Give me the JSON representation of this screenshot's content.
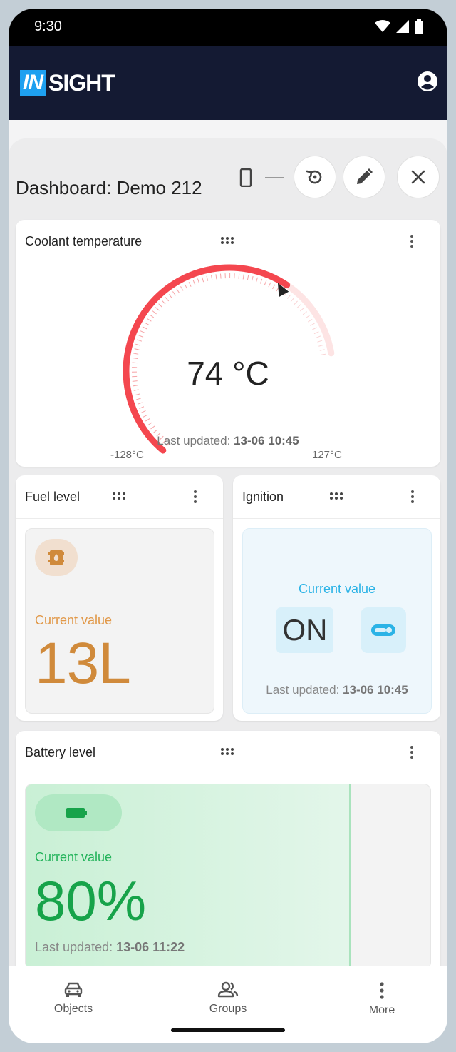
{
  "status_bar": {
    "time": "9:30"
  },
  "app": {
    "logo_in": "IN",
    "logo_rest": "SIGHT"
  },
  "dashboard": {
    "title": "Dashboard: Demo 212"
  },
  "coolant": {
    "title": "Coolant temperature",
    "value": "74 °C",
    "last_updated_label": "Last updated:",
    "last_updated_value": "13-06 10:45",
    "min_label": "-128°C",
    "max_label": "127°C",
    "gauge_fraction": 0.79,
    "accent": "#f4474f"
  },
  "fuel": {
    "title": "Fuel level",
    "current_label": "Current value",
    "value": "13L",
    "accent": "#d08a3b"
  },
  "ignition": {
    "title": "Ignition",
    "current_label": "Current value",
    "value": "ON",
    "last_updated_label": "Last updated:",
    "last_updated_value": "13-06 10:45",
    "accent": "#2bb3e6"
  },
  "battery": {
    "title": "Battery level",
    "current_label": "Current value",
    "value": "80%",
    "level_fraction": 0.8,
    "last_updated_label": "Last updated:",
    "last_updated_value": "13-06 11:22",
    "accent": "#17a34a"
  },
  "bottom_nav": {
    "items": [
      {
        "label": "Objects",
        "icon": "car-icon"
      },
      {
        "label": "Groups",
        "icon": "groups-icon"
      },
      {
        "label": "More",
        "icon": "more-vertical-icon"
      }
    ]
  }
}
